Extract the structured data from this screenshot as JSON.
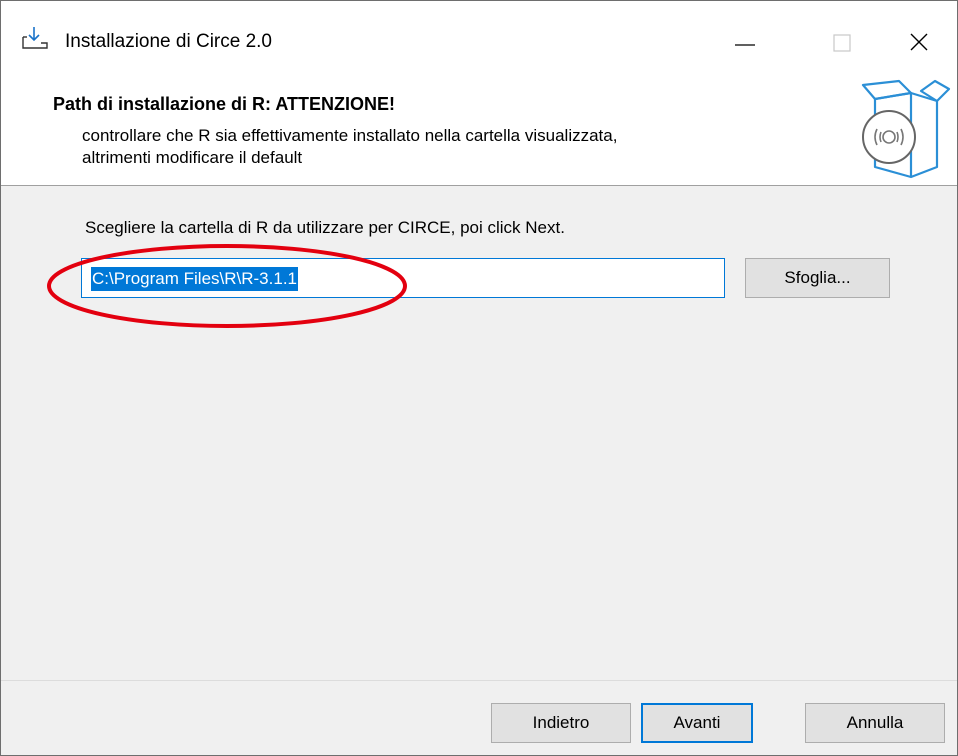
{
  "window": {
    "title": "Installazione di Circe 2.0"
  },
  "header": {
    "title": "Path di installazione di R: ATTENZIONE!",
    "description_line1": "controllare che R sia effettivamente installato nella cartella visualizzata,",
    "description_line2": "altrimenti modificare il default"
  },
  "body": {
    "instruction": "Scegliere la cartella di R da utilizzare per CIRCE, poi click Next.",
    "path_value": "C:\\Program Files\\R\\R-3.1.1",
    "browse_label": "Sfoglia..."
  },
  "footer": {
    "back_label": "Indietro",
    "next_label": "Avanti",
    "cancel_label": "Annulla"
  },
  "colors": {
    "accent": "#0078d7",
    "annotation": "#e3000f"
  },
  "icons": [
    "download-icon",
    "minimize-icon",
    "maximize-icon",
    "close-icon",
    "package-box-icon"
  ]
}
